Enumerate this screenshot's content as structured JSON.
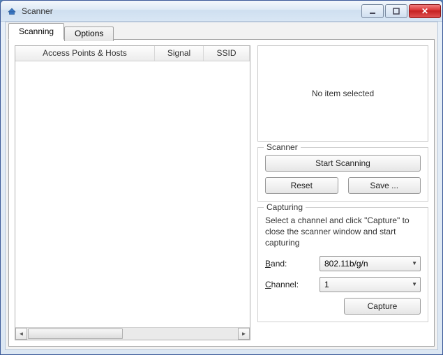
{
  "window": {
    "title": "Scanner"
  },
  "tabs": {
    "scanning": "Scanning",
    "options": "Options",
    "active": "scanning"
  },
  "list": {
    "columns": {
      "ap": "Access Points & Hosts",
      "signal": "Signal",
      "ssid": "SSID"
    }
  },
  "preview": {
    "empty": "No item selected"
  },
  "scanner": {
    "legend": "Scanner",
    "start": "Start Scanning",
    "reset": "Reset",
    "save": "Save ..."
  },
  "capturing": {
    "legend": "Capturing",
    "hint": "Select a channel and click \"Capture\" to close the scanner window and start capturing",
    "band_label_rest": "and:",
    "channel_label_rest": "hannel:",
    "band_value": "802.11b/g/n",
    "channel_value": "1",
    "capture": "Capture"
  }
}
